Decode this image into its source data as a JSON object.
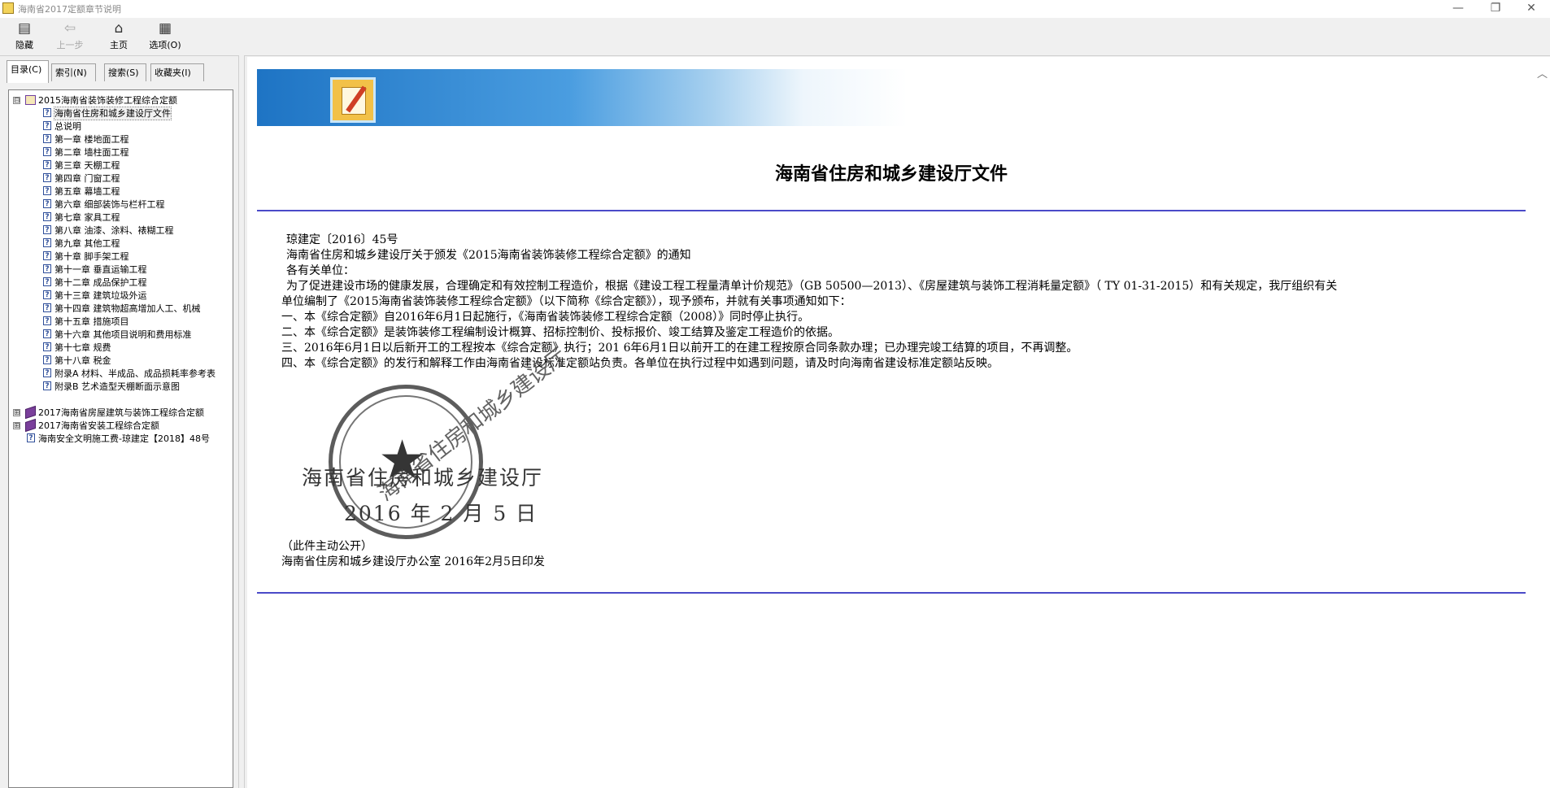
{
  "window": {
    "title": "海南省2017定额章节说明",
    "minimize": "—",
    "restore": "❐",
    "close": "✕"
  },
  "toolbar": {
    "buttons": [
      {
        "label": "隐藏",
        "icon": "hide-icon",
        "enabled": true
      },
      {
        "label": "上一步",
        "icon": "back-arrow-icon",
        "enabled": false
      },
      {
        "label": "主页",
        "icon": "home-icon",
        "enabled": true
      },
      {
        "label": "选项(O)",
        "icon": "options-icon",
        "enabled": true
      }
    ]
  },
  "tabs": [
    {
      "label": "目录(C)",
      "active": true
    },
    {
      "label": "索引(N)",
      "active": false
    },
    {
      "label": "搜索(S)",
      "active": false
    },
    {
      "label": "收藏夹(I)",
      "active": false
    }
  ],
  "tree": {
    "root_expanded": "2015海南省装饰装修工程综合定额",
    "root_expander": "⊟",
    "collapsed_expander": "⊞",
    "topic_glyph": "?",
    "children": [
      "海南省住房和城乡建设厅文件",
      "总说明",
      "第一章 楼地面工程",
      "第二章 墙柱面工程",
      "第三章 天棚工程",
      "第四章 门窗工程",
      "第五章 幕墙工程",
      "第六章 细部装饰与栏杆工程",
      "第七章 家具工程",
      "第八章 油漆、涂料、裱糊工程",
      "第九章 其他工程",
      "第十章 脚手架工程",
      "第十一章 垂直运输工程",
      "第十二章 成品保护工程",
      "第十三章 建筑垃圾外运",
      "第十四章 建筑物超高增加人工、机械",
      "第十五章 措施项目",
      "第十六章 其他项目说明和费用标准",
      "第十七章 规费",
      "第十八章 税金",
      "附录A 材料、半成品、成品损耗率参考表",
      "附录B 艺术造型天棚断面示意图"
    ],
    "collapsed_books": [
      "2017海南省房屋建筑与装饰工程综合定额",
      "2017海南省安装工程综合定额"
    ],
    "extra_topic": "海南安全文明施工费-琼建定【2018】48号",
    "selected": "海南省住房和城乡建设厅文件"
  },
  "document": {
    "title": "海南省住房和城乡建设厅文件",
    "doc_number": "琼建定〔2016〕45号",
    "notice_title": "海南省住房和城乡建设厅关于颁发《2015海南省装饰装修工程综合定额》的通知",
    "greeting": "各有关单位：",
    "para_intro_1": "为了促进建设市场的健康发展，合理确定和有效控制工程造价，根据《建设工程工程量清单计价规范》（GB 50500—2013）、《房屋建筑与装饰工程消耗量定额》（ TY 01-31-2015）和有关规定，我厅组织有关",
    "para_intro_2": "单位编制了《2015海南省装饰装修工程综合定额》（以下简称《综合定额》），现予颁布，并就有关事项通知如下：",
    "item_1": "一、本《综合定额》自2016年6月1日起施行，《海南省装饰装修工程综合定额（2008）》同时停止执行。",
    "item_2": "二、本《综合定额》是装饰装修工程编制设计概算、招标控制价、投标报价、竣工结算及鉴定工程造价的依据。",
    "item_3": "三、2016年6月1日以后新开工的工程按本《综合定额》执行；201 6年6月1日以前开工的在建工程按原合同条款办理；已办理完竣工结算的项目，不再调整。",
    "item_4": "四、本《综合定额》的发行和解释工作由海南省建设标准定额站负责。各单位在执行过程中如遇到问题，请及时向海南省建设标准定额站反映。",
    "signature_org": "海南省住房和城乡建设厅",
    "signature_date": "2016 年 2 月 5 日",
    "seal_text": "海南省住房和城乡建设厅",
    "seal_star": "★",
    "public_note": "（此件主动公开）",
    "issued_by": "海南省住房和城乡建设厅办公室  2016年2月5日印发"
  },
  "colors": {
    "rule": "#4a4ac8",
    "banner_start": "#1e74c4",
    "banner_end": "#ffffff"
  }
}
